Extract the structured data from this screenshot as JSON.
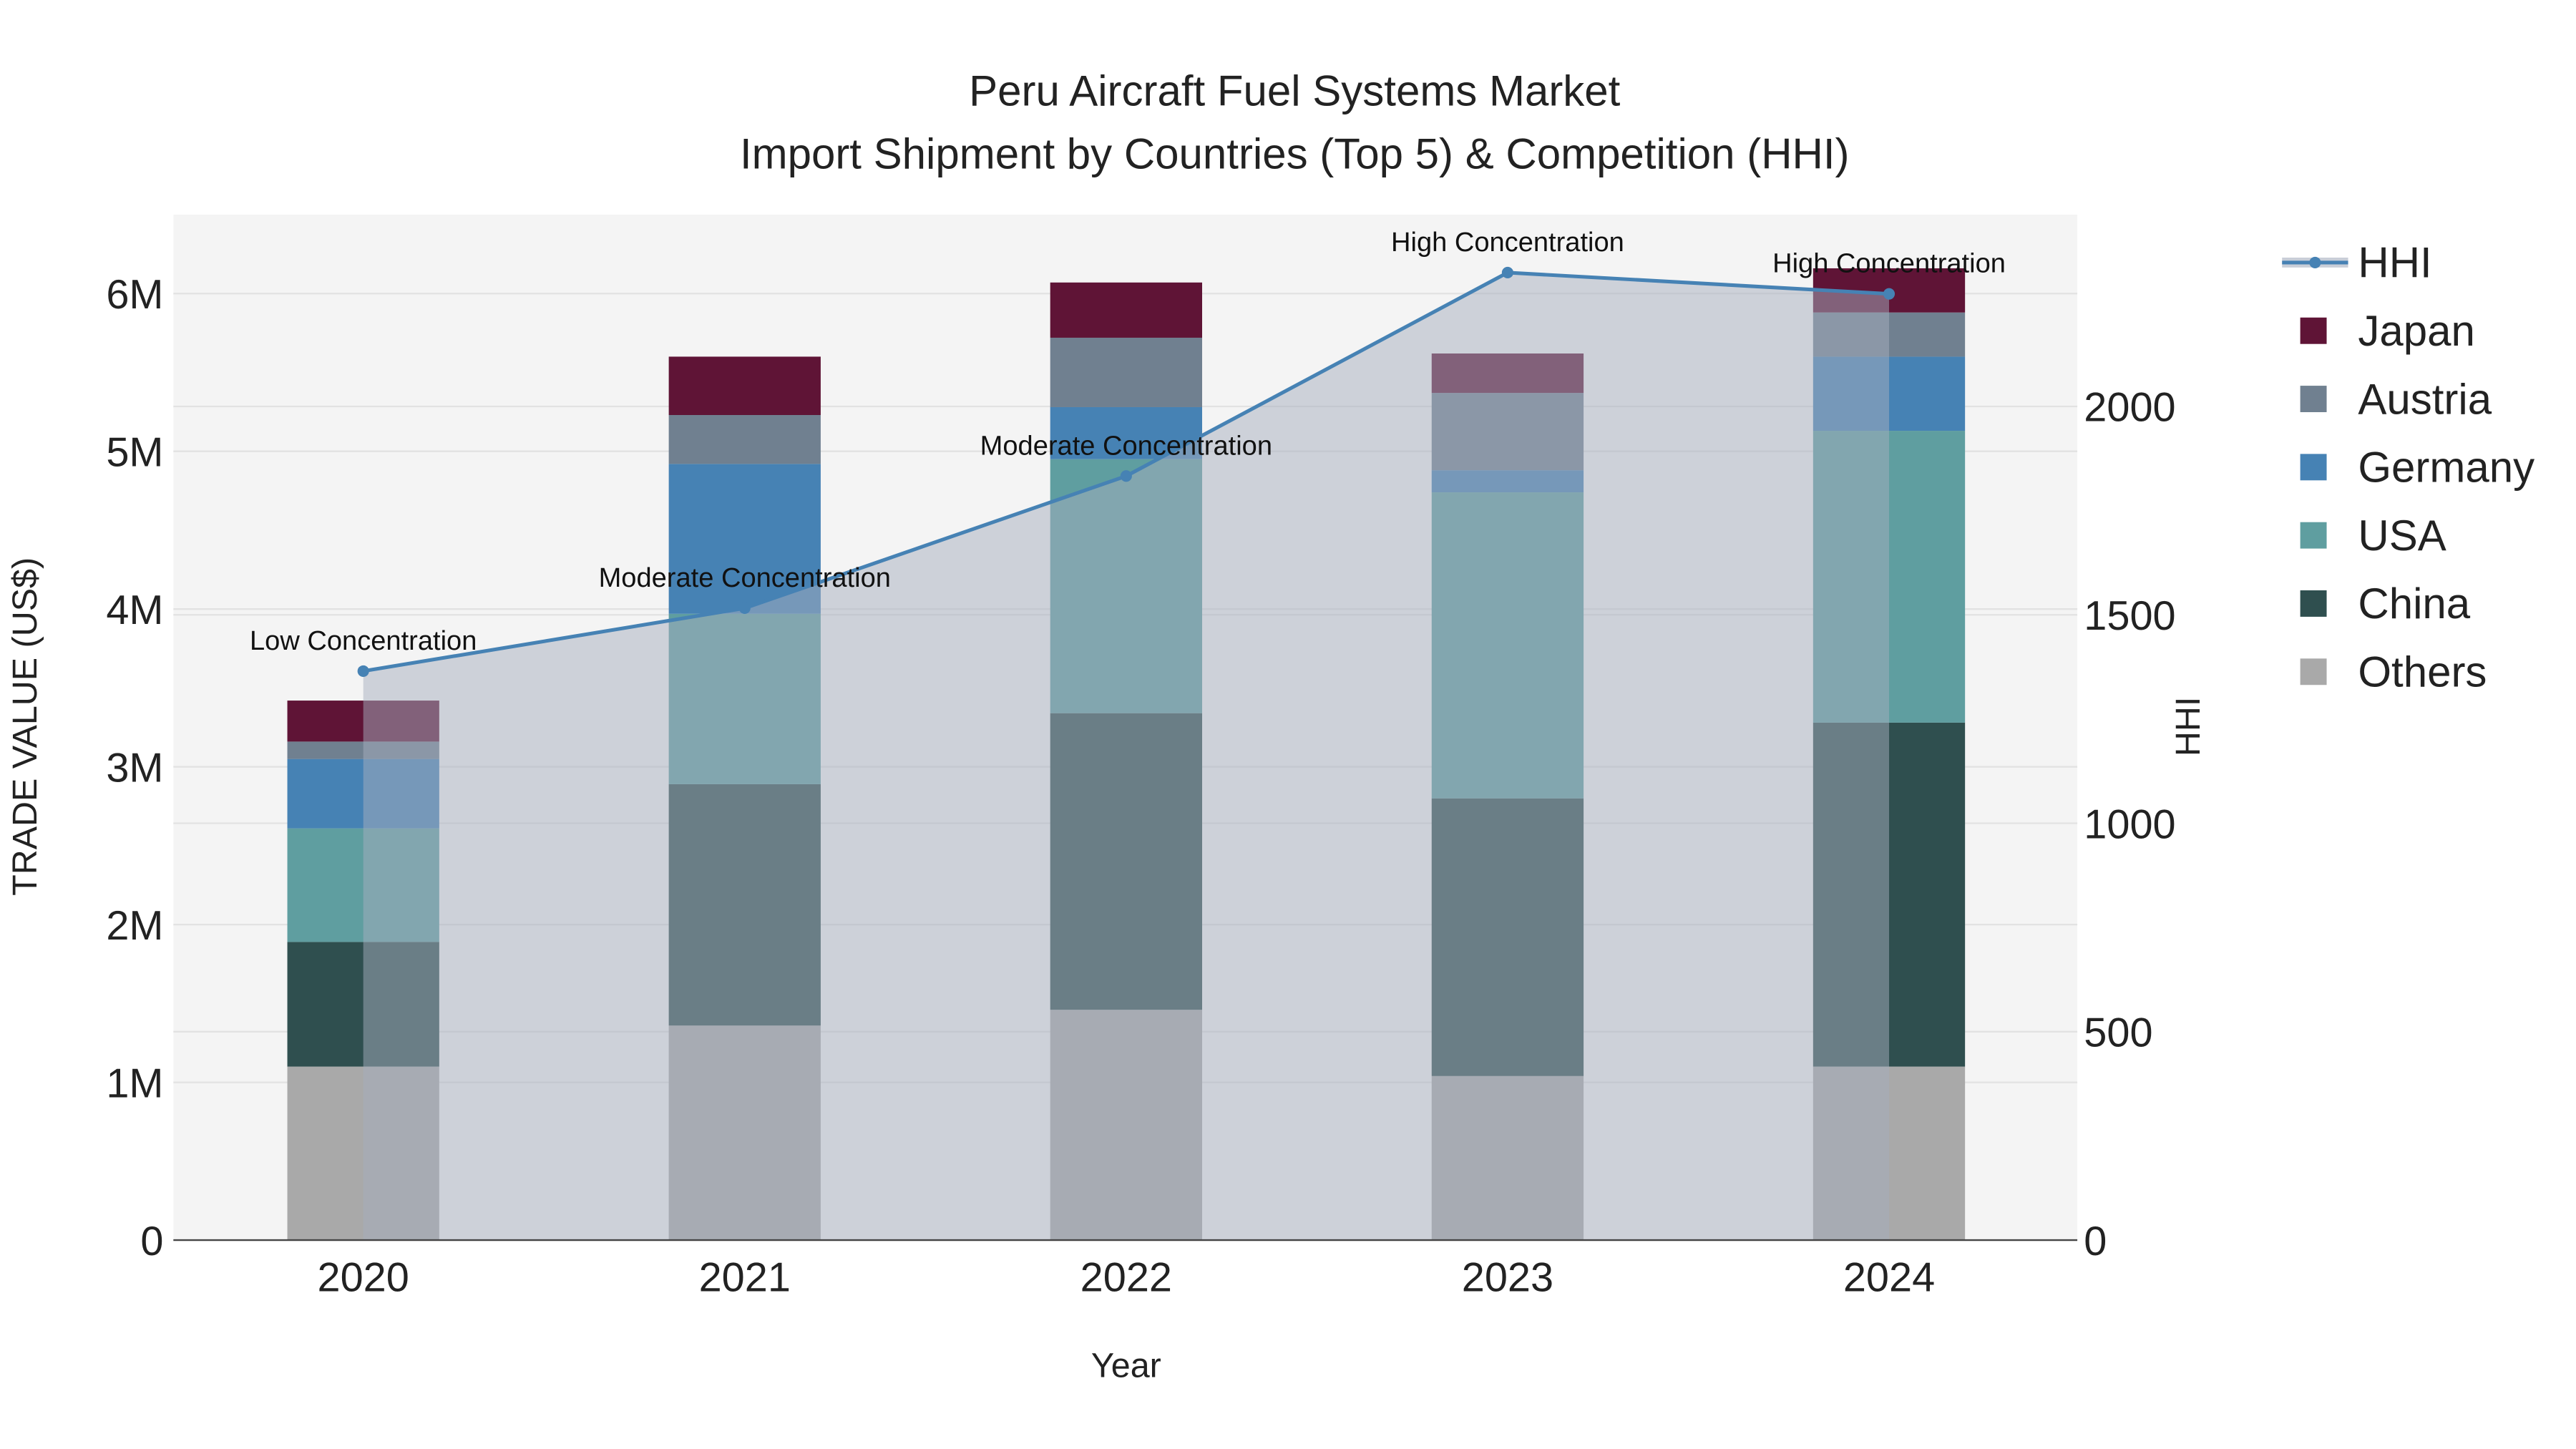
{
  "chart_data": {
    "type": "bar",
    "title": "Peru Aircraft Fuel Systems Market",
    "subtitle": "Import Shipment by Countries (Top 5) & Competition (HHI)",
    "xlabel": "Year",
    "ylabel": "TRADE VALUE (US$)",
    "y2label": "HHI",
    "categories": [
      "2020",
      "2021",
      "2022",
      "2023",
      "2024"
    ],
    "ylim": [
      0,
      6500000
    ],
    "y2lim": [
      0,
      2460
    ],
    "yticks": [
      {
        "v": 0,
        "label": "0"
      },
      {
        "v": 1000000,
        "label": "1M"
      },
      {
        "v": 2000000,
        "label": "2M"
      },
      {
        "v": 3000000,
        "label": "3M"
      },
      {
        "v": 4000000,
        "label": "4M"
      },
      {
        "v": 5000000,
        "label": "5M"
      },
      {
        "v": 6000000,
        "label": "6M"
      }
    ],
    "y2ticks": [
      {
        "v": 0,
        "label": "0"
      },
      {
        "v": 500,
        "label": "500"
      },
      {
        "v": 1000,
        "label": "1000"
      },
      {
        "v": 1500,
        "label": "1500"
      },
      {
        "v": 2000,
        "label": "2000"
      }
    ],
    "series": [
      {
        "name": "Others",
        "color": "#a9a9a9",
        "values": [
          1100000,
          1360000,
          1460000,
          1040000,
          1100000
        ]
      },
      {
        "name": "China",
        "color": "#2f4f4f",
        "values": [
          790000,
          1530000,
          1880000,
          1760000,
          2180000
        ]
      },
      {
        "name": "USA",
        "color": "#5f9ea0",
        "values": [
          720000,
          1080000,
          1610000,
          1940000,
          1850000
        ]
      },
      {
        "name": "Germany",
        "color": "#4682b4",
        "values": [
          440000,
          950000,
          330000,
          140000,
          470000
        ]
      },
      {
        "name": "Austria",
        "color": "#708090",
        "values": [
          110000,
          310000,
          440000,
          490000,
          280000
        ]
      },
      {
        "name": "Japan",
        "color": "#5f1436",
        "values": [
          260000,
          370000,
          350000,
          250000,
          280000
        ]
      }
    ],
    "hhi": {
      "name": "HHI",
      "color": "#4682b4",
      "values": [
        1365,
        1516,
        1833,
        2321,
        2270
      ],
      "annotations": [
        "Low Concentration",
        "Moderate Concentration",
        "Moderate Concentration",
        "High Concentration",
        "High Concentration"
      ]
    },
    "legend": [
      "HHI",
      "Japan",
      "Austria",
      "Germany",
      "USA",
      "China",
      "Others"
    ],
    "legend_position": "right",
    "grid": true
  }
}
